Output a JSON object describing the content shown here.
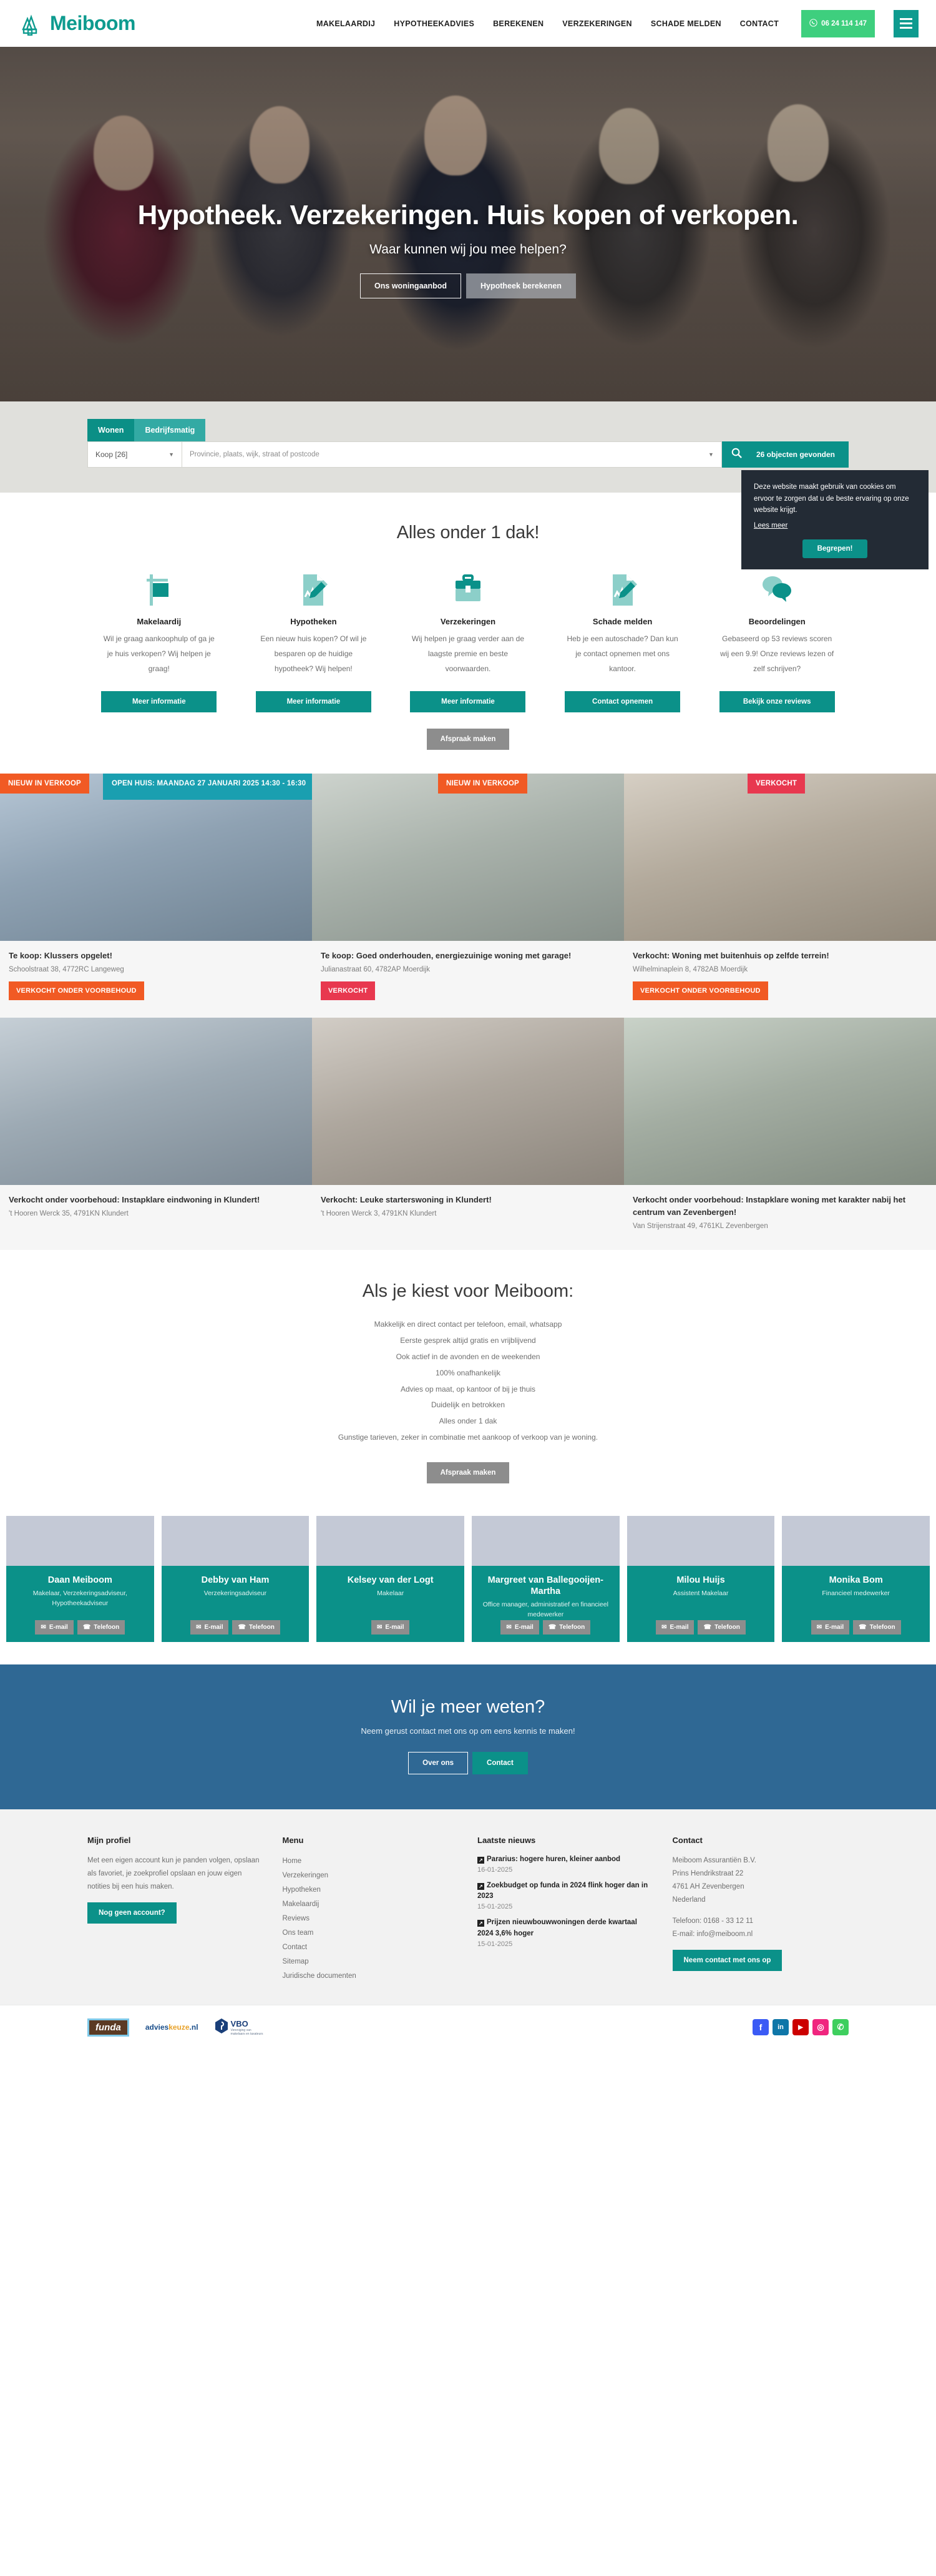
{
  "header": {
    "brand": "Meiboom",
    "nav": [
      {
        "label": "MAKELAARDIJ"
      },
      {
        "label": "HYPOTHEEKADVIES"
      },
      {
        "label": "BEREKENEN"
      },
      {
        "label": "VERZEKERINGEN"
      },
      {
        "label": "SCHADE MELDEN"
      },
      {
        "label": "CONTACT"
      }
    ],
    "phone": "06 24 114 147"
  },
  "hero": {
    "title": "Hypotheek. Verzekeringen. Huis kopen of verkopen.",
    "subtitle": "Waar kunnen wij jou mee helpen?",
    "btn_outline": "Ons woningaanbod",
    "btn_filled": "Hypotheek berekenen"
  },
  "search": {
    "tab_wonen": "Wonen",
    "tab_bedrijfsmatig": "Bedrijfsmatig",
    "type_value": "Koop [26]",
    "location_placeholder": "Provincie, plaats, wijk, straat of postcode",
    "results": "26 objecten gevonden"
  },
  "cookie": {
    "text": "Deze website maakt gebruik van cookies om ervoor te zorgen dat u de beste ervaring op onze website krijgt.",
    "link": "Lees meer",
    "button": "Begrepen!"
  },
  "services": {
    "title": "Alles onder 1 dak!",
    "items": [
      {
        "icon": "for-sale-sign-icon",
        "name": "Makelaardij",
        "desc": "Wil je graag aankoophulp of ga je je huis verkopen? Wij helpen je graag!",
        "button": "Meer informatie"
      },
      {
        "icon": "document-pen-icon",
        "name": "Hypotheken",
        "desc": "Een nieuw huis kopen? Of wil je besparen op de huidige hypotheek? Wij helpen!",
        "button": "Meer informatie"
      },
      {
        "icon": "briefcase-icon",
        "name": "Verzekeringen",
        "desc": "Wij helpen je graag verder aan de laagste premie en beste voorwaarden.",
        "button": "Meer informatie"
      },
      {
        "icon": "document-pen-icon",
        "name": "Schade melden",
        "desc": "Heb je een autoschade? Dan kun je contact opnemen met ons kantoor.",
        "button": "Contact opnemen"
      },
      {
        "icon": "chat-bubbles-icon",
        "name": "Beoordelingen",
        "desc": "Gebaseerd op 53 reviews scoren wij een 9.9! Onze reviews lezen of zelf schrijven?",
        "button": "Bekijk onze reviews"
      }
    ],
    "appointment_button": "Afspraak maken"
  },
  "listings": [
    {
      "ribbon": "NIEUW IN VERKOOP",
      "ribbon_type": "new",
      "open_house": "OPEN HUIS: MAANDAG 27 JANUARI 2025 14:30 - 16:30",
      "title": "Te koop: Klussers opgelet!",
      "address": "Schoolstraat 38, 4772RC Langeweg",
      "status": "VERKOCHT ONDER VOORBEHOUD",
      "status_type": "vov"
    },
    {
      "ribbon": "NIEUW IN VERKOOP",
      "ribbon_type": "new",
      "open_house": "",
      "title": "Te koop: Goed onderhouden, energiezuinige woning met garage!",
      "address": "Julianastraat 60, 4782AP Moerdijk",
      "status": "VERKOCHT",
      "status_type": "verk"
    },
    {
      "ribbon": "VERKOCHT",
      "ribbon_type": "sold",
      "open_house": "",
      "title": "Verkocht: Woning met buitenhuis op zelfde terrein!",
      "address": "Wilhelminaplein 8, 4782AB Moerdijk",
      "status": "VERKOCHT ONDER VOORBEHOUD",
      "status_type": "vov"
    },
    {
      "ribbon": "",
      "ribbon_type": "",
      "open_house": "",
      "title": "Verkocht onder voorbehoud: Instapklare eindwoning in Klundert!",
      "address": "'t Hooren Werck 35, 4791KN Klundert",
      "status": "",
      "status_type": ""
    },
    {
      "ribbon": "",
      "ribbon_type": "",
      "open_house": "",
      "title": "Verkocht: Leuke starterswoning in Klundert!",
      "address": "'t Hooren Werck 3, 4791KN Klundert",
      "status": "",
      "status_type": ""
    },
    {
      "ribbon": "",
      "ribbon_type": "",
      "open_house": "",
      "title": "Verkocht onder voorbehoud: Instapklare woning met karakter nabij het centrum van Zevenbergen!",
      "address": "Van Strijenstraat 49, 4761KL Zevenbergen",
      "status": "",
      "status_type": ""
    }
  ],
  "choose": {
    "title": "Als je kiest voor Meiboom:",
    "points": [
      "Makkelijk en direct contact per telefoon, email, whatsapp",
      "Eerste gesprek altijd gratis en vrijblijvend",
      "Ook actief in de avonden en de weekenden",
      "100% onafhankelijk",
      "Advies op maat, op kantoor of bij je thuis",
      "Duidelijk en betrokken",
      "Alles onder 1 dak",
      "Gunstige tarieven, zeker in combinatie met aankoop of verkoop van je woning."
    ],
    "button": "Afspraak maken"
  },
  "team": [
    {
      "name": "Daan Meiboom",
      "role": "Makelaar, Verzekeringsadviseur, Hypotheekadviseur",
      "email_label": "E-mail",
      "phone_label": "Telefoon"
    },
    {
      "name": "Debby van Ham",
      "role": "Verzekeringsadviseur",
      "email_label": "E-mail",
      "phone_label": "Telefoon"
    },
    {
      "name": "Kelsey van der Logt",
      "role": "Makelaar",
      "email_label": "E-mail",
      "phone_label": ""
    },
    {
      "name": "Margreet van Ballegooijen-Martha",
      "role": "Office manager, administratief en financieel medewerker",
      "email_label": "E-mail",
      "phone_label": "Telefoon"
    },
    {
      "name": "Milou Huijs",
      "role": "Assistent Makelaar",
      "email_label": "E-mail",
      "phone_label": "Telefoon"
    },
    {
      "name": "Monika Bom",
      "role": "Financieel medewerker",
      "email_label": "E-mail",
      "phone_label": "Telefoon"
    }
  ],
  "cta": {
    "title": "Wil je meer weten?",
    "subtitle": "Neem gerust contact met ons op om eens kennis te maken!",
    "btn_about": "Over ons",
    "btn_contact": "Contact"
  },
  "footer": {
    "profile": {
      "heading": "Mijn profiel",
      "text": "Met een eigen account kun je panden volgen, opslaan als favoriet, je zoekprofiel opslaan en jouw eigen notities bij een huis maken.",
      "button": "Nog geen account?"
    },
    "menu": {
      "heading": "Menu",
      "links": [
        "Home",
        "Verzekeringen",
        "Hypotheken",
        "Makelaardij",
        "Reviews",
        "Ons team",
        "Contact",
        "Sitemap",
        "Juridische documenten"
      ]
    },
    "news": {
      "heading": "Laatste nieuws",
      "items": [
        {
          "title": "Pararius: hogere huren, kleiner aanbod",
          "date": "16-01-2025"
        },
        {
          "title": "Zoekbudget op funda in 2024 flink hoger dan in 2023",
          "date": "15-01-2025"
        },
        {
          "title": "Prijzen nieuwbouwwoningen derde kwartaal 2024 3,6% hoger",
          "date": "15-01-2025"
        }
      ]
    },
    "contact": {
      "heading": "Contact",
      "company": "Meiboom Assurantiën B.V.",
      "street": "Prins Hendrikstraat 22",
      "city": "4761 AH Zevenbergen",
      "country": "Nederland",
      "phone": "Telefoon: 0168 - 33 12 11",
      "email": "E-mail: info@meiboom.nl",
      "button": "Neem contact met ons op"
    }
  },
  "bottom": {
    "partners": [
      {
        "name": "funda",
        "label": "funda"
      },
      {
        "name": "advieskeuze",
        "label_a": "advies",
        "label_b": "keuze",
        "label_c": ".nl"
      },
      {
        "name": "vbo",
        "label": "VBO",
        "sub1": "Vereniging van",
        "sub2": "makelaars en taxateurs"
      }
    ],
    "socials": [
      {
        "name": "facebook-icon",
        "glyph": "f",
        "color": "#3b5bf5"
      },
      {
        "name": "linkedin-icon",
        "glyph": "in",
        "color": "#0e76a8"
      },
      {
        "name": "youtube-icon",
        "glyph": "▶",
        "color": "#cc0000"
      },
      {
        "name": "instagram-icon",
        "glyph": "◎",
        "color": "#f0267f"
      },
      {
        "name": "whatsapp-icon",
        "glyph": "✆",
        "color": "#3ecf5e"
      }
    ]
  },
  "colors": {
    "teal": "#0b9189",
    "teal_dark": "#0b8f86",
    "orange": "#f15a24",
    "red": "#e8384f",
    "blue": "#2f6894",
    "cyan": "#1a9fb0",
    "green": "#3ecf7e"
  }
}
